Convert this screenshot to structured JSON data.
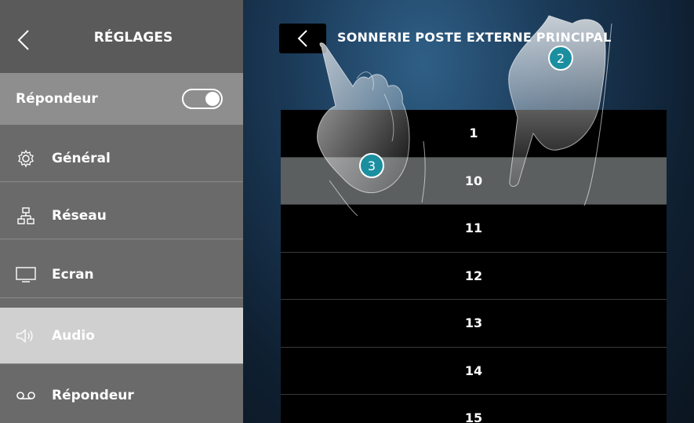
{
  "sidebar": {
    "title": "RÉGLAGES",
    "toggle_row": {
      "label": "Répondeur",
      "toggle_on": true
    },
    "items": [
      {
        "label": "Général",
        "icon": "gear-icon"
      },
      {
        "label": "Réseau",
        "icon": "network-icon"
      },
      {
        "label": "Ecran",
        "icon": "monitor-icon"
      },
      {
        "label": "Audio",
        "icon": "speaker-icon",
        "active": true
      },
      {
        "label": "Répondeur",
        "icon": "voicemail-icon"
      }
    ]
  },
  "main": {
    "title": "SONNERIE POSTE EXTERNE PRINCIPAL",
    "list": [
      "1",
      "10",
      "11",
      "12",
      "13",
      "14",
      "15"
    ],
    "selected_index": 1
  },
  "callouts": {
    "a": "2",
    "b": "3"
  },
  "colors": {
    "callout": "#1b8fa0",
    "selected_row": "#5c5f60",
    "sidebar": "#6a6a6a"
  }
}
